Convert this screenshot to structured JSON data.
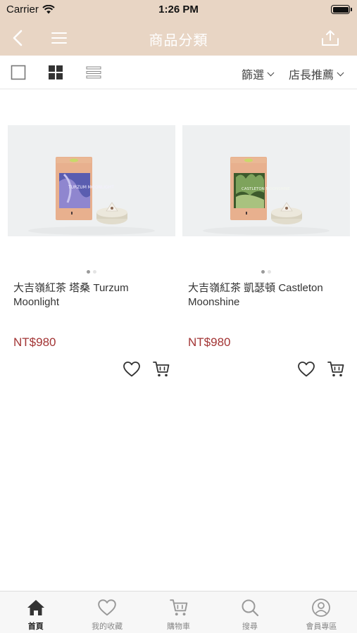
{
  "status_bar": {
    "carrier": "Carrier",
    "time": "1:26 PM"
  },
  "nav": {
    "title": "商品分類",
    "back_icon": "back-arrow-icon",
    "menu_icon": "hamburger-menu-icon",
    "share_icon": "share-icon"
  },
  "toolbar": {
    "views": [
      "single-view-icon",
      "grid-view-icon",
      "list-view-icon"
    ],
    "filter_label": "篩選",
    "sort_label": "店長推薦"
  },
  "products": [
    {
      "name": "大吉嶺紅茶 塔桑 Turzum Moonlight",
      "price": "NT$980",
      "package_color": "#5a5db0",
      "package_text": "TURZUM MOONLIGHT",
      "image_count": 2,
      "current_image": 1
    },
    {
      "name": "大吉嶺紅茶 凱瑟頓 Castleton Moonshine",
      "price": "NT$980",
      "package_color": "#3d5a2c",
      "package_text": "CASTLETON MOONSHINE",
      "image_count": 2,
      "current_image": 1
    }
  ],
  "tabs": [
    {
      "label": "首頁",
      "icon": "home-icon",
      "active": true
    },
    {
      "label": "我的收藏",
      "icon": "heart-icon",
      "active": false
    },
    {
      "label": "購物車",
      "icon": "cart-icon",
      "active": false
    },
    {
      "label": "搜尋",
      "icon": "search-icon",
      "active": false
    },
    {
      "label": "會員專區",
      "icon": "user-icon",
      "active": false
    }
  ],
  "colors": {
    "header_bg": "#e8d5c4",
    "price": "#a23434",
    "tab_active": "#222222"
  }
}
